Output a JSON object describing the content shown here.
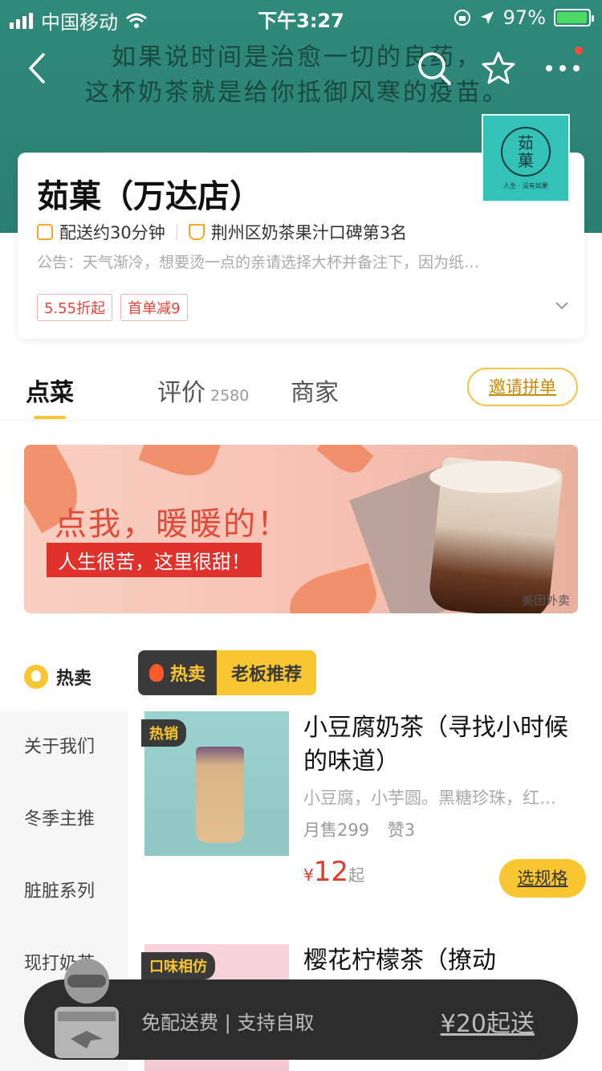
{
  "status_bar": {
    "carrier": "中国移动",
    "time": "下午3:27",
    "battery_percent": "97%",
    "battery_level": 0.97
  },
  "header": {
    "slogan_line1": "如果说时间是治愈一切的良药，",
    "slogan_line2": "这杯奶茶就是给你抵御风寒的疫苗。",
    "icons": {
      "back": "chevron-left-icon",
      "search": "search-icon",
      "favorite": "star-icon",
      "more": "more-icon"
    }
  },
  "logo": {
    "line1": "茹",
    "line2": "菓",
    "tagline": "人生 · 没有如果"
  },
  "shop": {
    "name": "茹菓（万达店）",
    "delivery_time": "配送约30分钟",
    "rank": "荆州区奶茶果汁口碑第3名",
    "notice": "公告：天气渐冷，想要烫一点的亲请选择大杯并备注下，因为纸…",
    "promos": [
      "5.55折起",
      "首单减9"
    ]
  },
  "tabs": {
    "items": [
      {
        "label": "点菜"
      },
      {
        "label": "评价",
        "count": "2580"
      },
      {
        "label": "商家"
      }
    ],
    "invite_label": "邀请拼单"
  },
  "banner": {
    "title": "点我，暖暖的！",
    "subtitle": "人生很苦，这里很甜！",
    "watermark": "美团外卖"
  },
  "sidebar": {
    "hot_label": "热卖",
    "items": [
      "关于我们",
      "冬季主推",
      "脏脏系列",
      "现打奶茶"
    ]
  },
  "section": {
    "hot": "热卖",
    "recommend": "老板推荐"
  },
  "products": [
    {
      "badge": "热销",
      "name": "小豆腐奶茶（寻找小时候的味道）",
      "desc": "小豆腐，小芋圆。黑糖珍珠，红…",
      "monthly_sales": "月售299",
      "likes": "赞3",
      "currency": "¥",
      "price": "12",
      "price_suffix": "起",
      "button": "选规格"
    },
    {
      "badge": "口味相仿",
      "name": "樱花柠檬茶（撩动"
    }
  ],
  "cart": {
    "text": "免配送费 | 支持自取",
    "min_order": "¥20起送"
  },
  "colors": {
    "brand_yellow": "#f8c631",
    "header_teal": "#2f8a7a",
    "price_red": "#e03c2d"
  }
}
